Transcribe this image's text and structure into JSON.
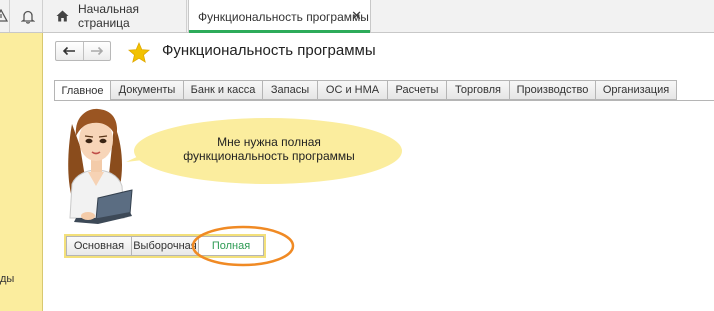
{
  "topbar": {
    "home_tab_label": "Начальная страница",
    "active_tab_label": "Функциональность программы",
    "close_glyph": "✕"
  },
  "leftpanel": {
    "cut_text": "ды"
  },
  "header": {
    "back_glyph": "←",
    "forward_glyph": "→",
    "title": "Функциональность программы"
  },
  "tabs": [
    {
      "label": "Главное"
    },
    {
      "label": "Документы"
    },
    {
      "label": "Банк и касса"
    },
    {
      "label": "Запасы"
    },
    {
      "label": "ОС и НМА"
    },
    {
      "label": "Расчеты"
    },
    {
      "label": "Торговля"
    },
    {
      "label": "Производство"
    },
    {
      "label": "Организация"
    }
  ],
  "bubble": {
    "line1": "Мне нужна полная",
    "line2": "функциональность программы"
  },
  "mode": {
    "options": [
      "Основная",
      "Выборочная",
      "Полная"
    ],
    "selected": "Полная"
  },
  "colors": {
    "accent_green": "#2dab5a",
    "panel_yellow": "#fbed9e",
    "bubble_yellow": "#fbed9e",
    "highlight_orange": "#f08a24",
    "star_gold": "#f2c200"
  },
  "icons": {
    "warn": "warning-icon",
    "bell": "bell-icon",
    "home": "home-icon",
    "star": "star-icon"
  }
}
